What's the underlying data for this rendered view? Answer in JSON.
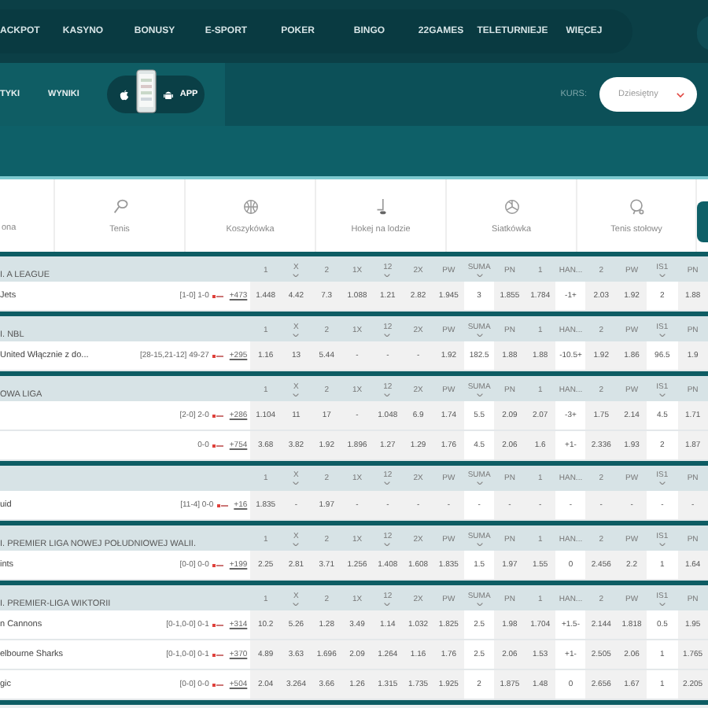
{
  "top_nav": {
    "items": [
      "ACKPOT",
      "KASYNO",
      "BONUSY",
      "E-SPORT",
      "POKER",
      "BINGO",
      "22GAMES",
      "TELETURNIEJE",
      "WIĘCEJ"
    ]
  },
  "sub_nav": {
    "items": [
      "TYKI",
      "WYNIKI"
    ],
    "app_button": "APP",
    "odds_format": {
      "label": "KURS:",
      "value": "Dziesiętny"
    }
  },
  "sports_tabs": [
    {
      "label": "ona",
      "kind": "none"
    },
    {
      "label": "Tenis",
      "kind": "racket"
    },
    {
      "label": "Koszykówka",
      "kind": "basketball"
    },
    {
      "label": "Hokej na lodzie",
      "kind": "hockey"
    },
    {
      "label": "Siatkówka",
      "kind": "volleyball"
    },
    {
      "label": "Tenis stołowy",
      "kind": "pingpong"
    }
  ],
  "column_styles": [
    {
      "kind": "odds",
      "dropdown": false
    },
    {
      "kind": "odds",
      "dropdown": true
    },
    {
      "kind": "odds",
      "dropdown": false
    },
    {
      "kind": "odds",
      "dropdown": false
    },
    {
      "kind": "odds",
      "dropdown": true
    },
    {
      "kind": "odds",
      "dropdown": false
    },
    {
      "kind": "odds",
      "dropdown": false
    },
    {
      "kind": "line",
      "dropdown": true
    },
    {
      "kind": "odds",
      "dropdown": false
    },
    {
      "kind": "odds",
      "dropdown": false
    },
    {
      "kind": "line",
      "dropdown": false
    },
    {
      "kind": "odds",
      "dropdown": false
    },
    {
      "kind": "odds",
      "dropdown": false
    },
    {
      "kind": "line",
      "dropdown": true
    },
    {
      "kind": "odds",
      "dropdown": false
    }
  ],
  "leagues": [
    {
      "name": "I. A LEAGUE",
      "columns": [
        "1",
        "X",
        "2",
        "1X",
        "12",
        "2X",
        "PW",
        "SUMA",
        "PN",
        "1",
        "HAN...",
        "2",
        "PW",
        "IS1",
        "PN"
      ],
      "matches": [
        {
          "team": "Jets",
          "score": "[1-0] 1-0",
          "more": "+473",
          "odds": [
            "1.448",
            "4.42",
            "7.3",
            "1.088",
            "1.21",
            "2.82",
            "1.945",
            "3",
            "1.855",
            "1.784",
            "-1+",
            "2.03",
            "1.92",
            "2",
            "1.88"
          ]
        }
      ]
    },
    {
      "name": "I. NBL",
      "columns": [
        "1",
        "X",
        "2",
        "1X",
        "12",
        "2X",
        "PW",
        "SUMA",
        "PN",
        "1",
        "HAN...",
        "2",
        "PW",
        "IS1",
        "PN"
      ],
      "matches": [
        {
          "team": "United Włącznie z do...",
          "score": "[28-15,21-12] 49-27",
          "more": "+295",
          "odds": [
            "1.16",
            "13",
            "5.44",
            "-",
            "-",
            "-",
            "1.92",
            "182.5",
            "1.88",
            "1.88",
            "-10.5+",
            "1.92",
            "1.86",
            "96.5",
            "1.9"
          ]
        }
      ]
    },
    {
      "name": "OWA LIGA",
      "columns": [
        "1",
        "X",
        "2",
        "1X",
        "12",
        "2X",
        "PW",
        "SUMA",
        "PN",
        "1",
        "HAN...",
        "2",
        "PW",
        "IS1",
        "PN"
      ],
      "matches": [
        {
          "score": "[2-0] 2-0",
          "more": "+286",
          "odds": [
            "1.104",
            "11",
            "17",
            "-",
            "1.048",
            "6.9",
            "1.74",
            "5.5",
            "2.09",
            "2.07",
            "-3+",
            "1.75",
            "2.14",
            "4.5",
            "1.71"
          ]
        },
        {
          "score": "0-0",
          "more": "+754",
          "odds": [
            "3.68",
            "3.82",
            "1.92",
            "1.896",
            "1.27",
            "1.29",
            "1.76",
            "4.5",
            "2.06",
            "1.6",
            "+1-",
            "2.336",
            "1.93",
            "2",
            "1.87"
          ]
        }
      ]
    },
    {
      "columns": [
        "1",
        "X",
        "2",
        "1X",
        "12",
        "2X",
        "PW",
        "SUMA",
        "PN",
        "1",
        "HAN...",
        "2",
        "PW",
        "IS1",
        "PN"
      ],
      "matches": [
        {
          "team": "uid",
          "score": "[11-4] 0-0",
          "more": "+16",
          "odds": [
            "1.835",
            "-",
            "1.97",
            "-",
            "-",
            "-",
            "-",
            "-",
            "-",
            "-",
            "-",
            "-",
            "-",
            "-",
            "-"
          ]
        }
      ]
    },
    {
      "name": "I. PREMIER LIGA NOWEJ POŁUDNIOWEJ WALII.",
      "columns": [
        "1",
        "X",
        "2",
        "1X",
        "12",
        "2X",
        "PW",
        "SUMA",
        "PN",
        "1",
        "HAN...",
        "2",
        "PW",
        "IS1",
        "PN"
      ],
      "matches": [
        {
          "team": "ints",
          "score": "[0-0] 0-0",
          "more": "+199",
          "odds": [
            "2.25",
            "2.81",
            "3.71",
            "1.256",
            "1.408",
            "1.608",
            "1.835",
            "1.5",
            "1.97",
            "1.55",
            "0",
            "2.456",
            "2.2",
            "1",
            "1.64"
          ]
        }
      ]
    },
    {
      "name": "I. PREMIER-LIGA WIKTORII",
      "columns": [
        "1",
        "X",
        "2",
        "1X",
        "12",
        "2X",
        "PW",
        "SUMA",
        "PN",
        "1",
        "HAN...",
        "2",
        "PW",
        "IS1",
        "PN"
      ],
      "matches": [
        {
          "team": "n Cannons",
          "score": "[0-1,0-0] 0-1",
          "more": "+314",
          "odds": [
            "10.2",
            "5.26",
            "1.28",
            "3.49",
            "1.14",
            "1.032",
            "1.825",
            "2.5",
            "1.98",
            "1.704",
            "+1.5-",
            "2.144",
            "1.818",
            "0.5",
            "1.95"
          ]
        },
        {
          "team": "elbourne Sharks",
          "score": "[0-1,0-0] 0-1",
          "more": "+370",
          "odds": [
            "4.89",
            "3.63",
            "1.696",
            "2.09",
            "1.264",
            "1.16",
            "1.76",
            "2.5",
            "2.06",
            "1.53",
            "+1-",
            "2.505",
            "2.06",
            "1",
            "1.765"
          ]
        },
        {
          "team": "gic",
          "score": "[0-0] 0-0",
          "more": "+504",
          "odds": [
            "2.04",
            "3.264",
            "3.66",
            "1.26",
            "1.315",
            "1.735",
            "1.925",
            "2",
            "1.875",
            "1.48",
            "0",
            "2.656",
            "1.67",
            "1",
            "2.205"
          ]
        }
      ]
    }
  ]
}
